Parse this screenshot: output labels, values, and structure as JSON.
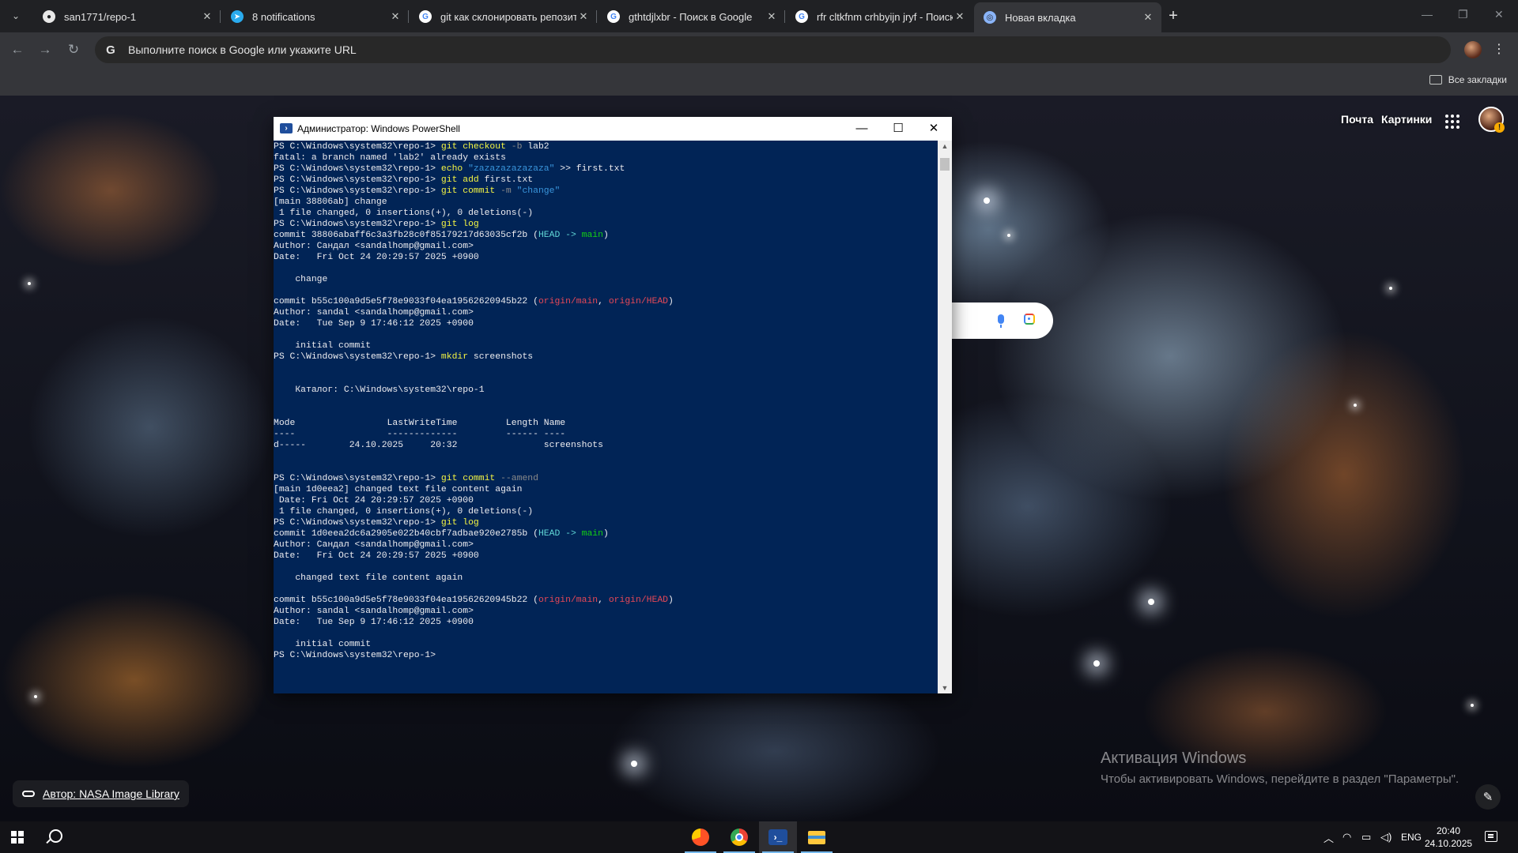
{
  "browser": {
    "tabs": [
      {
        "title": "san1771/repo-1",
        "favicon": "github-icon"
      },
      {
        "title": "8 notifications",
        "favicon": "telegram-icon"
      },
      {
        "title": "git как склонировать репозиторий",
        "favicon": "google-icon"
      },
      {
        "title": "gthtdjlxbr - Поиск в Google",
        "favicon": "google-icon"
      },
      {
        "title": "rfr cltkfnm crhbyijn jryf - Поиск",
        "favicon": "google-icon"
      },
      {
        "title": "Новая вкладка",
        "favicon": "chrome-icon",
        "active": true
      }
    ],
    "omnibox_placeholder": "Выполните поиск в Google или укажите URL",
    "bookmarks_all": "Все закладки"
  },
  "ntp": {
    "links": {
      "mail": "Почта",
      "images": "Картинки"
    },
    "attribution": "Автор: NASA Image Library"
  },
  "powershell": {
    "title": "Администратор: Windows PowerShell",
    "prompt": "PS C:\\Windows\\system32\\repo-1> ",
    "lines": [
      [
        {
          "t": "PS C:\\Windows\\system32\\repo-1> "
        },
        {
          "t": "git checkout",
          "c": "cmd"
        },
        {
          "t": " -b",
          "c": "par"
        },
        {
          "t": " lab2"
        }
      ],
      [
        {
          "t": "fatal: a branch named 'lab2' already exists"
        }
      ],
      [
        {
          "t": "PS C:\\Windows\\system32\\repo-1> "
        },
        {
          "t": "echo",
          "c": "cmd"
        },
        {
          "t": " \"zazazazazazaza\"",
          "c": "str"
        },
        {
          "t": " >> first.txt"
        }
      ],
      [
        {
          "t": "PS C:\\Windows\\system32\\repo-1> "
        },
        {
          "t": "git add",
          "c": "cmd"
        },
        {
          "t": " first.txt"
        }
      ],
      [
        {
          "t": "PS C:\\Windows\\system32\\repo-1> "
        },
        {
          "t": "git commit",
          "c": "cmd"
        },
        {
          "t": " -m",
          "c": "par"
        },
        {
          "t": " \"change\"",
          "c": "str"
        }
      ],
      [
        {
          "t": "[main 38806ab] change"
        }
      ],
      [
        {
          "t": " 1 file changed, 0 insertions(+), 0 deletions(-)"
        }
      ],
      [
        {
          "t": "PS C:\\Windows\\system32\\repo-1> "
        },
        {
          "t": "git log",
          "c": "cmd"
        }
      ],
      [
        {
          "t": "commit 38806abaff6c3a3fb28c0f85179217d63035cf2b ("
        },
        {
          "t": "HEAD -> ",
          "c": "cyan"
        },
        {
          "t": "main",
          "c": "grn"
        },
        {
          "t": ")"
        }
      ],
      [
        {
          "t": "Author: Сандал <sandalhomp@gmail.com>"
        }
      ],
      [
        {
          "t": "Date:   Fri Oct 24 20:29:57 2025 +0900"
        }
      ],
      [
        {
          "t": ""
        }
      ],
      [
        {
          "t": "    change"
        }
      ],
      [
        {
          "t": ""
        }
      ],
      [
        {
          "t": "commit b55c100a9d5e5f78e9033f04ea19562620945b22 ("
        },
        {
          "t": "origin/main",
          "c": "red"
        },
        {
          "t": ", "
        },
        {
          "t": "origin/HEAD",
          "c": "red"
        },
        {
          "t": ")"
        }
      ],
      [
        {
          "t": "Author: sandal <sandalhomp@gmail.com>"
        }
      ],
      [
        {
          "t": "Date:   Tue Sep 9 17:46:12 2025 +0900"
        }
      ],
      [
        {
          "t": ""
        }
      ],
      [
        {
          "t": "    initial commit"
        }
      ],
      [
        {
          "t": "PS C:\\Windows\\system32\\repo-1> "
        },
        {
          "t": "mkdir",
          "c": "cmd"
        },
        {
          "t": " screenshots"
        }
      ],
      [
        {
          "t": ""
        }
      ],
      [
        {
          "t": ""
        }
      ],
      [
        {
          "t": "    Каталог: C:\\Windows\\system32\\repo-1"
        }
      ],
      [
        {
          "t": ""
        }
      ],
      [
        {
          "t": ""
        }
      ],
      [
        {
          "t": "Mode                 LastWriteTime         Length Name"
        }
      ],
      [
        {
          "t": "----                 -------------         ------ ----"
        }
      ],
      [
        {
          "t": "d-----        24.10.2025     20:32                screenshots"
        }
      ],
      [
        {
          "t": ""
        }
      ],
      [
        {
          "t": ""
        }
      ],
      [
        {
          "t": "PS C:\\Windows\\system32\\repo-1> "
        },
        {
          "t": "git commit",
          "c": "cmd"
        },
        {
          "t": " --amend",
          "c": "par"
        }
      ],
      [
        {
          "t": "[main 1d0eea2] changed text file content again"
        }
      ],
      [
        {
          "t": " Date: Fri Oct 24 20:29:57 2025 +0900"
        }
      ],
      [
        {
          "t": " 1 file changed, 0 insertions(+), 0 deletions(-)"
        }
      ],
      [
        {
          "t": "PS C:\\Windows\\system32\\repo-1> "
        },
        {
          "t": "git log",
          "c": "cmd"
        }
      ],
      [
        {
          "t": "commit 1d0eea2dc6a2905e022b40cbf7adbae920e2785b ("
        },
        {
          "t": "HEAD -> ",
          "c": "cyan"
        },
        {
          "t": "main",
          "c": "grn"
        },
        {
          "t": ")"
        }
      ],
      [
        {
          "t": "Author: Сандал <sandalhomp@gmail.com>"
        }
      ],
      [
        {
          "t": "Date:   Fri Oct 24 20:29:57 2025 +0900"
        }
      ],
      [
        {
          "t": ""
        }
      ],
      [
        {
          "t": "    changed text file content again"
        }
      ],
      [
        {
          "t": ""
        }
      ],
      [
        {
          "t": "commit b55c100a9d5e5f78e9033f04ea19562620945b22 ("
        },
        {
          "t": "origin/main",
          "c": "red"
        },
        {
          "t": ", "
        },
        {
          "t": "origin/HEAD",
          "c": "red"
        },
        {
          "t": ")"
        }
      ],
      [
        {
          "t": "Author: sandal <sandalhomp@gmail.com>"
        }
      ],
      [
        {
          "t": "Date:   Tue Sep 9 17:46:12 2025 +0900"
        }
      ],
      [
        {
          "t": ""
        }
      ],
      [
        {
          "t": "    initial commit"
        }
      ],
      [
        {
          "t": "PS C:\\Windows\\system32\\repo-1> "
        }
      ]
    ]
  },
  "watermark": {
    "line1": "Активация Windows",
    "line2": "Чтобы активировать Windows, перейдите в раздел \"Параметры\"."
  },
  "taskbar": {
    "apps": [
      "yandex-browser-icon",
      "chrome-icon",
      "powershell-icon",
      "file-explorer-icon"
    ],
    "language": "ENG",
    "time": "20:40",
    "date": "24.10.2025"
  },
  "colors": {
    "ps_background": "#012456",
    "ps_command": "#f5f543",
    "ps_string": "#3a96dd",
    "ps_parameter": "#8a8a8a",
    "git_head": "#61d6d6",
    "git_branch": "#13d113",
    "git_remote": "#e74856",
    "chrome_frame": "#202124"
  }
}
